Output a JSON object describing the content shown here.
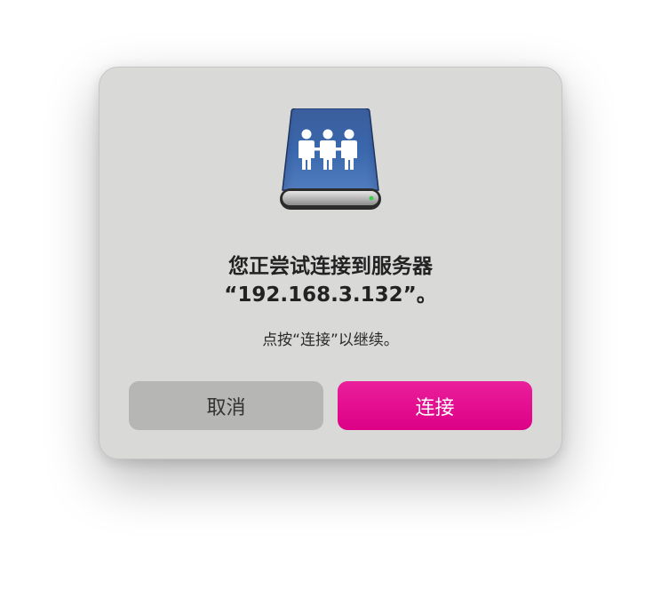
{
  "dialog": {
    "icon": "network-server-drive-icon",
    "title_line1": "您正尝试连接到服务器",
    "title_line2": "“192.168.3.132”。",
    "message": "点按“连接”以继续。",
    "cancel_label": "取消",
    "connect_label": "连接"
  },
  "colors": {
    "accent": "#e2007f",
    "dialog_background": "#d9d9d8",
    "cancel_button": "#b6b6b5"
  }
}
